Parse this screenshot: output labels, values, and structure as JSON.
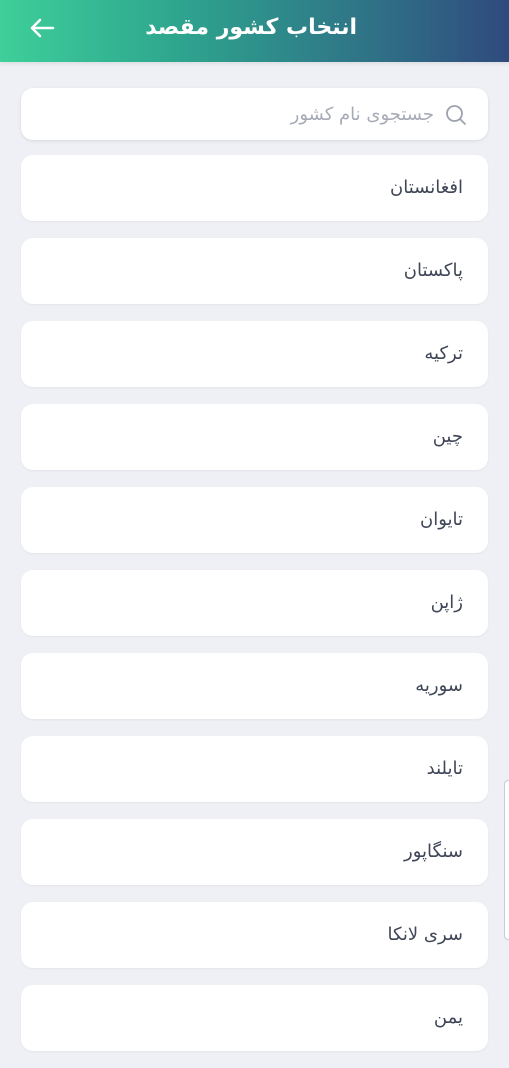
{
  "header": {
    "title": "انتخاب کشور مقصد",
    "back_icon": "arrow-left-icon",
    "gradient": [
      "#3ecf9a",
      "#2f4a7d"
    ]
  },
  "search": {
    "placeholder": "جستجوی نام کشور",
    "value": "",
    "icon": "search-icon"
  },
  "countries": [
    "افغانستان",
    "پاکستان",
    "ترکیه",
    "چین",
    "تایوان",
    "ژاپن",
    "سوریه",
    "تایلند",
    "سنگاپور",
    "سری لانکا",
    "یمن"
  ],
  "colors": {
    "background": "#eef0f5",
    "card": "#ffffff",
    "text": "#3f4657",
    "placeholder": "#a7abb7"
  }
}
